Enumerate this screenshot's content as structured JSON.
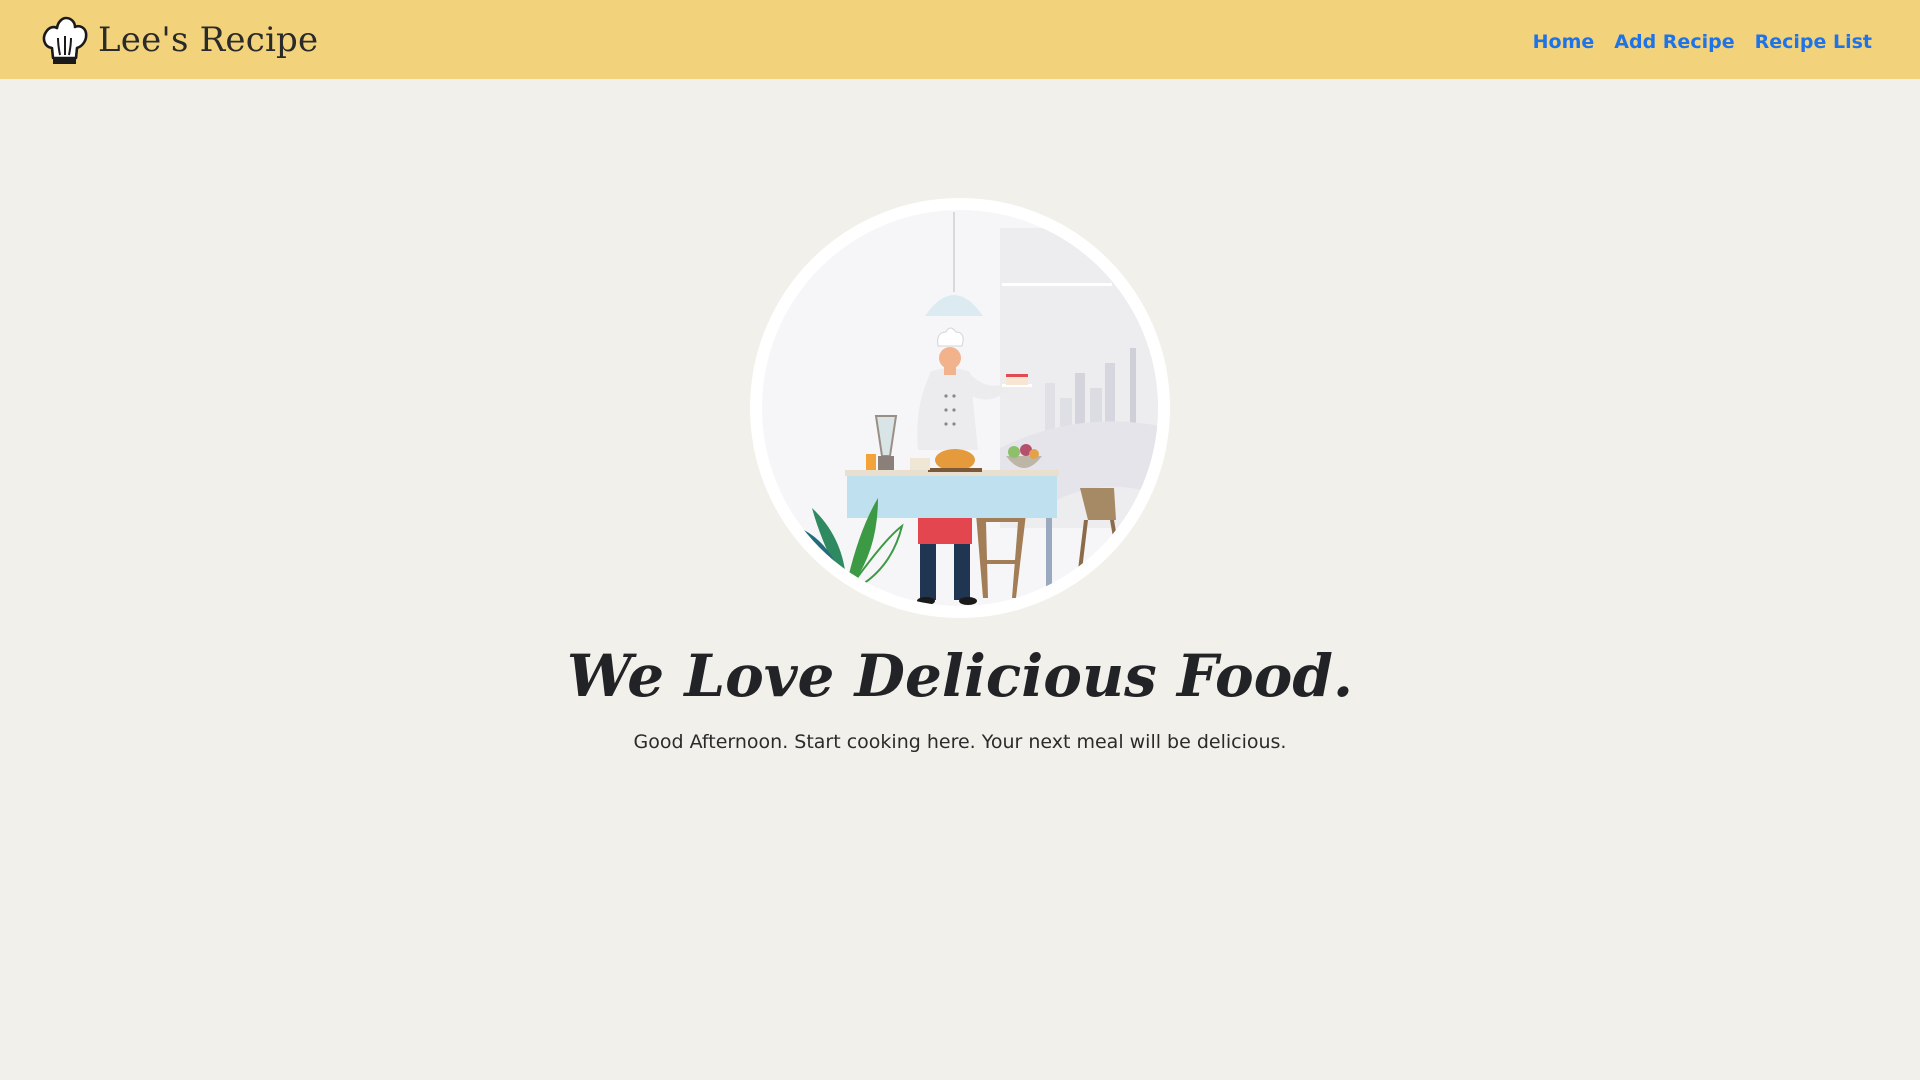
{
  "navbar": {
    "brand_name": "Lee's Recipe",
    "brand_icon": "chef-hat-icon",
    "links": [
      {
        "label": "Home"
      },
      {
        "label": "Add Recipe"
      },
      {
        "label": "Recipe List"
      }
    ],
    "background_color": "#f2d37b",
    "link_color": "#1e73e8"
  },
  "hero": {
    "image": "chef-cooking-illustration",
    "title": "We Love Delicious Food.",
    "subtitle": "Good Afternoon. Start cooking here. Your next meal will be delicious."
  },
  "page": {
    "background_color": "#f2f0ea"
  }
}
